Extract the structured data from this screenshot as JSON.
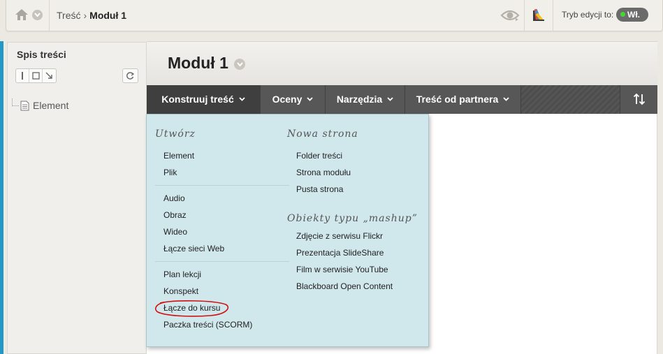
{
  "breadcrumb": {
    "parent": "Treść",
    "separator": "›",
    "current": "Moduł 1"
  },
  "edit_mode": {
    "label": "Tryb edycji to:",
    "state": "Wł.",
    "dot_color": "#49d436"
  },
  "sidebar": {
    "title": "Spis treści",
    "tree": [
      {
        "label": "Element",
        "icon": "document-icon"
      }
    ]
  },
  "page": {
    "title": "Moduł 1"
  },
  "action_bar": {
    "items": [
      {
        "label": "Konstruuj treść"
      },
      {
        "label": "Oceny"
      },
      {
        "label": "Narzędzia"
      },
      {
        "label": "Treść od partnera"
      }
    ],
    "sort_icon": "sort-icon"
  },
  "menu": {
    "left": {
      "heading": "Utwórz",
      "groups": [
        [
          "Element",
          "Plik"
        ],
        [
          "Audio",
          "Obraz",
          "Wideo",
          "Łącze sieci Web"
        ],
        [
          "Plan lekcji",
          "Konspekt",
          "Łącze do kursu",
          "Paczka treści (SCORM)"
        ]
      ]
    },
    "right": {
      "sections": [
        {
          "heading": "Nowa strona",
          "items": [
            "Folder treści",
            "Strona modułu",
            "Pusta strona"
          ]
        },
        {
          "heading": "Obiekty typu „mashup”",
          "items": [
            "Zdjęcie z serwisu Flickr",
            "Prezentacja SlideShare",
            "Film w serwisie YouTube",
            "Blackboard Open Content"
          ]
        }
      ]
    },
    "highlight_color": "#d01010",
    "background": "#d0e7ec"
  },
  "colors": {
    "accent_stripe": "#2597c7",
    "action_bar": "#575757"
  }
}
